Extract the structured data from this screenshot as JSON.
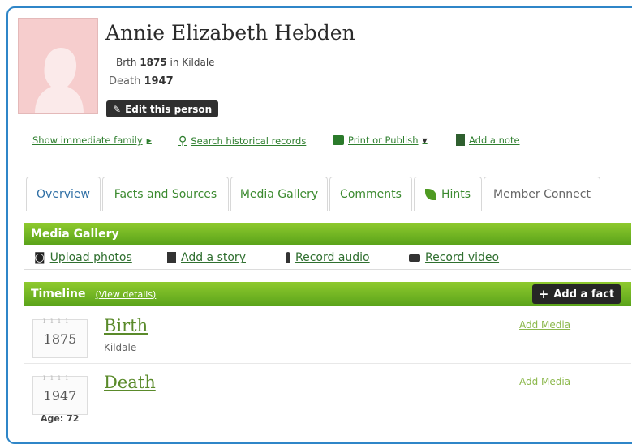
{
  "person": {
    "name": "Annie Elizabeth Hebden",
    "birth_label": "Brth",
    "birth_year": "1875",
    "birth_in": "in",
    "birth_place": "Kildale",
    "death_label": "Death",
    "death_year": "1947",
    "edit_label": "Edit this person"
  },
  "actions": {
    "show_family": "Show immediate family",
    "search_records": "Search historical records",
    "print_publish": "Print or Publish",
    "add_note": "Add a note"
  },
  "tabs": [
    "Overview",
    "Facts and Sources",
    "Media Gallery",
    "Comments",
    "Hints",
    "Member Connect"
  ],
  "media_gallery": {
    "title": "Media Gallery",
    "upload_photos": "Upload photos",
    "add_story": "Add a story",
    "record_audio": "Record audio",
    "record_video": "Record video"
  },
  "timeline": {
    "title": "Timeline",
    "view_details": "View details",
    "add_fact": "Add a fact",
    "events": [
      {
        "year": "1875",
        "title": "Birth",
        "place": "Kildale",
        "add_media": "Add Media"
      },
      {
        "year": "1947",
        "title": "Death",
        "age": "Age: 72",
        "add_media": "Add Media"
      }
    ]
  },
  "colors": {
    "frame_border": "#2f86c8",
    "green_bar": "#6db522",
    "link_green": "#3b8a2f",
    "dark_button": "#262626"
  },
  "icons": [
    "pencil-icon",
    "search-icon",
    "printer-icon",
    "note-icon",
    "camera-icon",
    "document-icon",
    "microphone-icon",
    "video-camera-icon",
    "leaf-icon",
    "plus-icon",
    "calendar-icon"
  ]
}
